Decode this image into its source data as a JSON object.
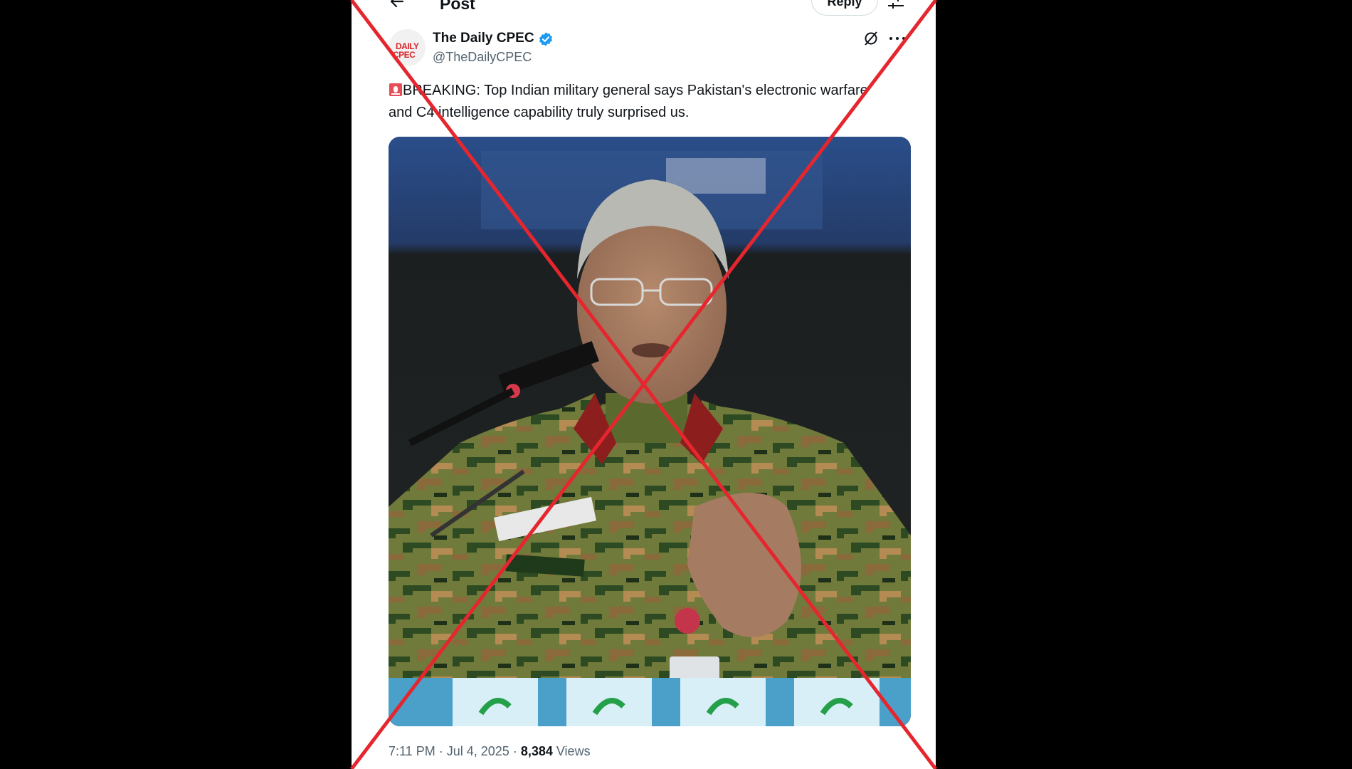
{
  "header": {
    "title": "Post",
    "reply_label": "Reply"
  },
  "post": {
    "author_name": "The Daily CPEC",
    "author_handle": "@TheDailyCPEC",
    "avatar_text_line1": "DAILY",
    "avatar_text_line2": "CPEC",
    "text": "BREAKING: Top Indian military general says Pakistan's electronic warfare and C4 intelligence capability truly surprised us.",
    "time": "7:11 PM",
    "date": "Jul 4, 2025",
    "views_count": "8,384",
    "views_label": "Views"
  },
  "colors": {
    "verified": "#1d9bf0",
    "cross": "#e5262e",
    "text_primary": "#0f1419",
    "text_secondary": "#536471"
  },
  "icons": [
    "back-arrow-icon",
    "settings-sliders-icon",
    "verified-badge-icon",
    "grok-icon",
    "more-icon",
    "siren-icon"
  ]
}
